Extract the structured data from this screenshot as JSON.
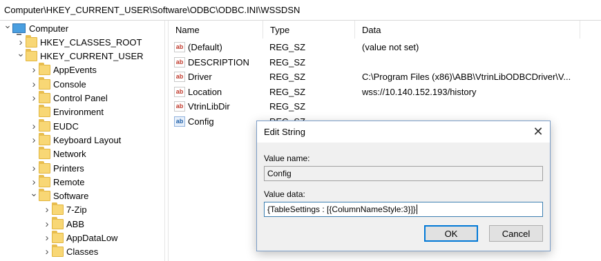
{
  "address": "Computer\\HKEY_CURRENT_USER\\Software\\ODBC\\ODBC.INI\\WSSDSN",
  "tree": [
    {
      "label": "Computer",
      "depth": 0,
      "expander": "open",
      "icon": "computer-icon"
    },
    {
      "label": "HKEY_CLASSES_ROOT",
      "depth": 1,
      "expander": "closed",
      "icon": "folder-icon"
    },
    {
      "label": "HKEY_CURRENT_USER",
      "depth": 1,
      "expander": "open",
      "icon": "folder-icon"
    },
    {
      "label": "AppEvents",
      "depth": 2,
      "expander": "closed",
      "icon": "folder-icon"
    },
    {
      "label": "Console",
      "depth": 2,
      "expander": "closed",
      "icon": "folder-icon"
    },
    {
      "label": "Control Panel",
      "depth": 2,
      "expander": "closed",
      "icon": "folder-icon"
    },
    {
      "label": "Environment",
      "depth": 2,
      "expander": "none",
      "icon": "folder-icon"
    },
    {
      "label": "EUDC",
      "depth": 2,
      "expander": "closed",
      "icon": "folder-icon"
    },
    {
      "label": "Keyboard Layout",
      "depth": 2,
      "expander": "closed",
      "icon": "folder-icon"
    },
    {
      "label": "Network",
      "depth": 2,
      "expander": "none",
      "icon": "folder-icon"
    },
    {
      "label": "Printers",
      "depth": 2,
      "expander": "closed",
      "icon": "folder-icon"
    },
    {
      "label": "Remote",
      "depth": 2,
      "expander": "closed",
      "icon": "folder-icon"
    },
    {
      "label": "Software",
      "depth": 2,
      "expander": "open",
      "icon": "folder-icon"
    },
    {
      "label": "7-Zip",
      "depth": 3,
      "expander": "closed",
      "icon": "folder-icon"
    },
    {
      "label": "ABB",
      "depth": 3,
      "expander": "closed",
      "icon": "folder-icon"
    },
    {
      "label": "AppDataLow",
      "depth": 3,
      "expander": "closed",
      "icon": "folder-icon"
    },
    {
      "label": "Classes",
      "depth": 3,
      "expander": "closed",
      "icon": "folder-icon"
    }
  ],
  "columns": {
    "name": "Name",
    "type": "Type",
    "data": "Data"
  },
  "values": [
    {
      "name": "(Default)",
      "type": "REG_SZ",
      "data": "(value not set)",
      "icon": "string-value-icon"
    },
    {
      "name": "DESCRIPTION",
      "type": "REG_SZ",
      "data": "",
      "icon": "string-value-icon"
    },
    {
      "name": "Driver",
      "type": "REG_SZ",
      "data": "C:\\Program Files (x86)\\ABB\\VtrinLibODBCDriver\\V...",
      "icon": "string-value-icon"
    },
    {
      "name": "Location",
      "type": "REG_SZ",
      "data": "wss://10.140.152.193/history",
      "icon": "string-value-icon"
    },
    {
      "name": "VtrinLibDir",
      "type": "REG_SZ",
      "data": "",
      "icon": "string-value-icon"
    },
    {
      "name": "Config",
      "type": "REG_SZ",
      "data": "",
      "icon": "config-value-icon"
    }
  ],
  "dialog": {
    "title": "Edit String",
    "close_glyph": "✕",
    "value_name_label": "Value name:",
    "value_name": "Config",
    "value_data_label": "Value data:",
    "value_data": "{TableSettings : [{ColumnNameStyle:3}]}",
    "ok_label": "OK",
    "cancel_label": "Cancel"
  },
  "icons": {
    "string_glyph": "ab"
  },
  "colors": {
    "accent": "#0078d7",
    "folder": "#f8d775"
  }
}
